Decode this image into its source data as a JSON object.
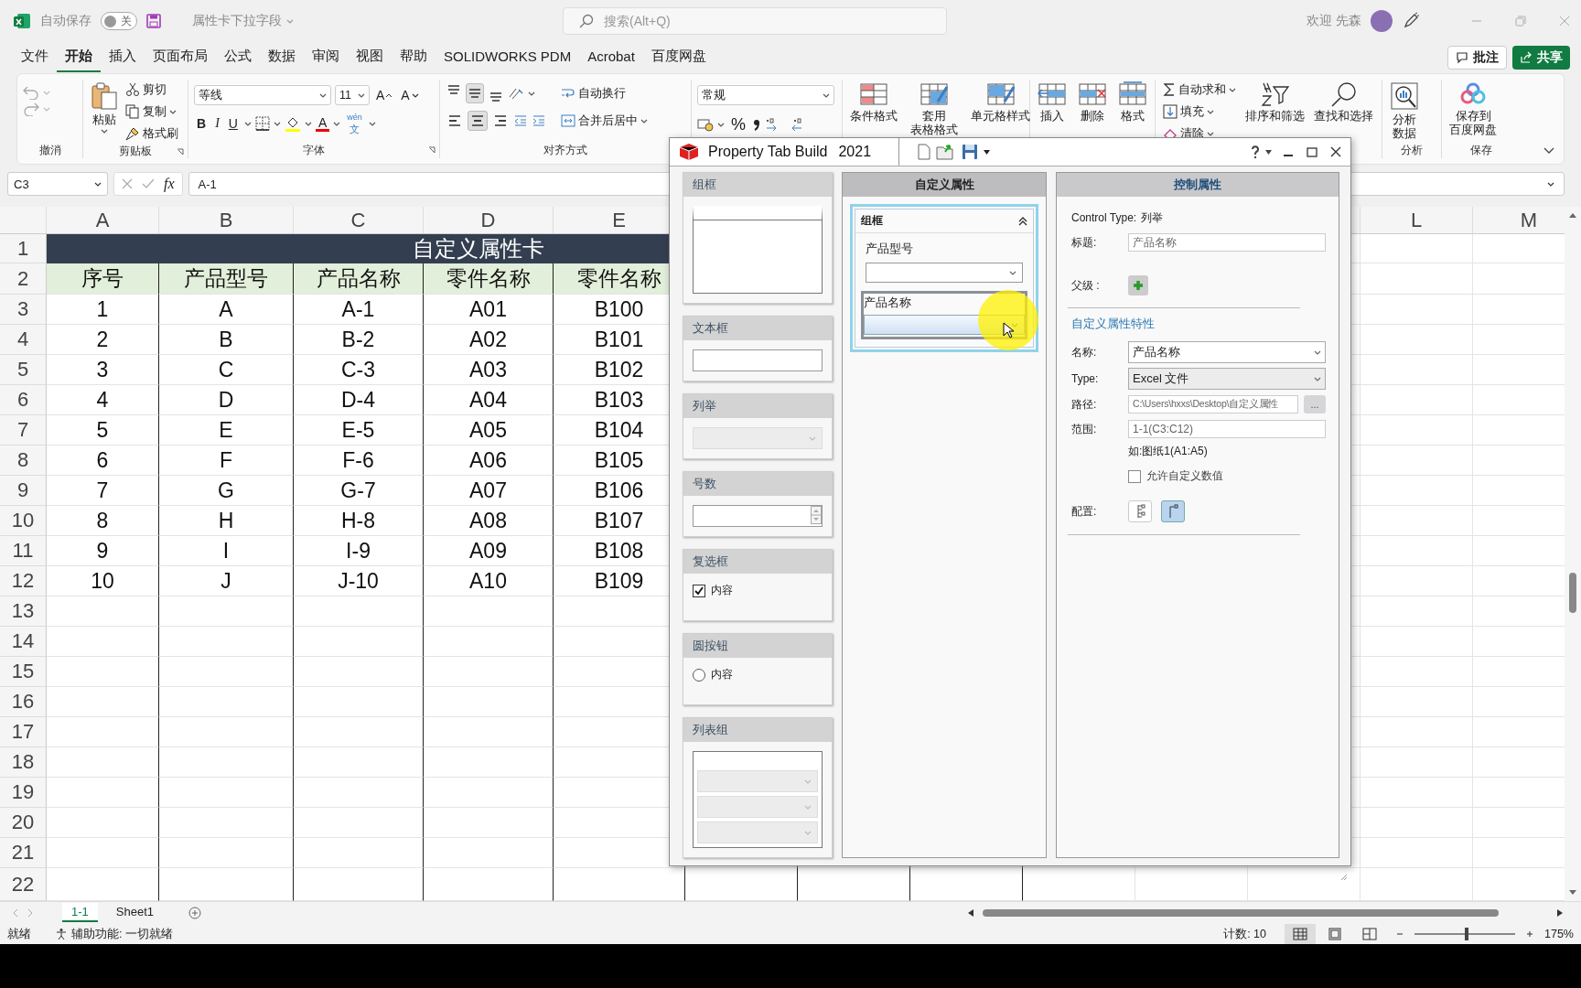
{
  "title_bar": {
    "autosave_label": "自动保存",
    "autosave_on": false,
    "autosave_state": "关",
    "document": "属性卡下拉字段",
    "search_placeholder": "搜索(Alt+Q)",
    "user": "欢迎 先森"
  },
  "menu_tabs": [
    {
      "label": "文件",
      "selected": false
    },
    {
      "label": "开始",
      "selected": true
    },
    {
      "label": "插入",
      "selected": false
    },
    {
      "label": "页面布局",
      "selected": false
    },
    {
      "label": "公式",
      "selected": false
    },
    {
      "label": "数据",
      "selected": false
    },
    {
      "label": "审阅",
      "selected": false
    },
    {
      "label": "视图",
      "selected": false
    },
    {
      "label": "帮助",
      "selected": false
    },
    {
      "label": "SOLIDWORKS PDM",
      "selected": false
    },
    {
      "label": "Acrobat",
      "selected": false
    },
    {
      "label": "百度网盘",
      "selected": false
    }
  ],
  "comment_button": "批注",
  "share_button": "共享",
  "ribbon": {
    "undo": {
      "group": "撤消"
    },
    "clipboard": {
      "group": "剪贴板",
      "paste": "粘贴",
      "cut": "剪切",
      "copy": "复制",
      "format_painter": "格式刷"
    },
    "font": {
      "group": "字体",
      "font_name": "等线",
      "font_size": "11",
      "grow": "A",
      "shrink": "A",
      "bold": "B",
      "italic": "I",
      "underline": "U",
      "font_color": "A",
      "phonetic_top": "wén",
      "phonetic_bottom": "文"
    },
    "alignment": {
      "group": "对齐方式",
      "vertical": [
        {
          "selected": false
        },
        {
          "selected": true
        },
        {
          "selected": false
        }
      ],
      "horizontal": [
        {
          "selected": false
        },
        {
          "selected": true
        },
        {
          "selected": false
        }
      ],
      "wrap_text": "自动换行",
      "merge_center": "合并后居中"
    },
    "number": {
      "format": "常规",
      "percent": "%"
    },
    "styles": {
      "conditional": "条件格式",
      "table_top": "套用",
      "table_bottom": "表格格式",
      "cell_styles": "单元格样式"
    },
    "cells": {
      "insert": "插入",
      "delete": "删除",
      "format": "格式"
    },
    "editing": {
      "autosum": "自动求和",
      "fill": "填充",
      "clear": "清除",
      "sort_filter": "排序和筛选",
      "find_select": "查找和选择"
    },
    "analysis": {
      "group": "分析",
      "top": "分析",
      "bottom": "数据"
    },
    "save": {
      "group": "保存",
      "top": "保存到",
      "bottom": "百度网盘"
    }
  },
  "formula_bar": {
    "name_box": "C3",
    "fx": "fx",
    "formula": "A-1"
  },
  "sheet": {
    "columns": [
      "A",
      "B",
      "C",
      "D",
      "E",
      "L",
      "M"
    ],
    "title": "自定义属性卡",
    "headers": [
      "序号",
      "产品型号",
      "产品名称",
      "零件名称",
      "零件名称"
    ],
    "rows": [
      [
        "1",
        "A",
        "A-1",
        "A01",
        "B100"
      ],
      [
        "2",
        "B",
        "B-2",
        "A02",
        "B101"
      ],
      [
        "3",
        "C",
        "C-3",
        "A03",
        "B102"
      ],
      [
        "4",
        "D",
        "D-4",
        "A04",
        "B103"
      ],
      [
        "5",
        "E",
        "E-5",
        "A05",
        "B104"
      ],
      [
        "6",
        "F",
        "F-6",
        "A06",
        "B105"
      ],
      [
        "7",
        "G",
        "G-7",
        "A07",
        "B106"
      ],
      [
        "8",
        "H",
        "H-8",
        "A08",
        "B107"
      ],
      [
        "9",
        "I",
        "I-9",
        "A09",
        "B108"
      ],
      [
        "10",
        "J",
        "J-10",
        "A10",
        "B109"
      ]
    ],
    "row_numbers": [
      "1",
      "2",
      "3",
      "4",
      "5",
      "6",
      "7",
      "8",
      "9",
      "10",
      "11",
      "12",
      "13",
      "14",
      "15",
      "16",
      "17",
      "18",
      "19",
      "20",
      "21",
      "22"
    ]
  },
  "sheet_tabs": [
    {
      "label": "1-1",
      "selected": true
    },
    {
      "label": "Sheet1",
      "selected": false
    }
  ],
  "status_bar": {
    "ready": "就绪",
    "accessibility": "辅助功能: 一切就绪",
    "count": "计数: 10",
    "views": [
      {
        "selected": true
      },
      {
        "selected": false
      },
      {
        "selected": false
      }
    ],
    "zoom": {
      "level": 0.52,
      "reading": "175%"
    }
  },
  "dialog": {
    "title": "Property Tab Build",
    "version": "2021",
    "palette": [
      {
        "kind": "groupbox",
        "title": "组框"
      },
      {
        "kind": "textbox",
        "title": "文本框"
      },
      {
        "kind": "list",
        "title": "列举"
      },
      {
        "kind": "number",
        "title": "号数"
      },
      {
        "kind": "checkbox",
        "title": "复选框",
        "option": "内容",
        "checked": true
      },
      {
        "kind": "radio",
        "title": "圆按钮",
        "option": "内容",
        "selected": false
      },
      {
        "kind": "listgroup",
        "title": "列表组"
      }
    ],
    "canvas": {
      "header": "自定义属性",
      "group_title": "组框",
      "controls": [
        {
          "label": "产品型号",
          "selected": false
        },
        {
          "label": "产品名称",
          "selected": true
        }
      ]
    },
    "properties": {
      "header": "控制属性",
      "control_type_label": "Control Type:",
      "control_type": "列举",
      "caption_label": "标题:",
      "caption": "产品名称",
      "parent_label": "父级 :",
      "section": "自定义属性特性",
      "name_label": "名称:",
      "name": "产品名称",
      "type_label": "Type:",
      "type": "Excel 文件",
      "path_label": "路径:",
      "path": "C:\\Users\\hxxs\\Desktop\\自定义属性",
      "browse": "...",
      "range_label": "范围:",
      "range": "1-1(C3:C12)",
      "range_hint": "如:图纸1(A1:A5)",
      "allow_custom": {
        "label": "允许自定义数值",
        "checked": false
      },
      "config_label": "配置:",
      "layouts": [
        {
          "selected": false
        },
        {
          "selected": true
        }
      ]
    }
  }
}
